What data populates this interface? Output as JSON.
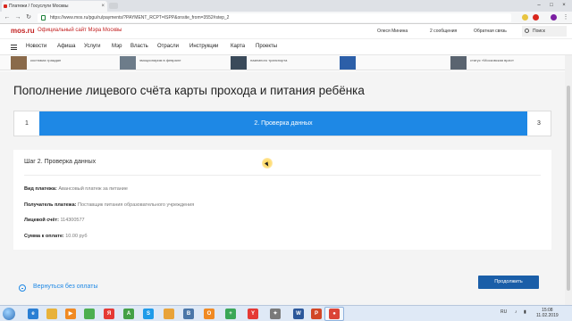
{
  "browser": {
    "tab_title": "Платежи / Госуслуги Москвы",
    "tab_close": "×",
    "url": "https://www.mos.ru/pgu/ru/payments/?PAYMENT_RCPT=ISPP&onsite_from=3552#step_2",
    "window_controls": [
      "–",
      "□",
      "×"
    ]
  },
  "header": {
    "logo": "mos.ru",
    "site_title": "Официальный сайт Мэра Москвы",
    "user_name": "Олеся Минина",
    "messages": "2 сообщения",
    "feedback": "Обратная связь",
    "search_label": "Поиск"
  },
  "nav": {
    "items": [
      "Новости",
      "Афиша",
      "Услуги",
      "Мэр",
      "Власть",
      "Отрасли",
      "Инструкции",
      "Карта",
      "Проекты"
    ]
  },
  "news": {
    "items": [
      {
        "text": "костюмах граждан",
        "color": "#8a6a4a"
      },
      {
        "text": "эмоционирим в феврале",
        "color": "#6d7c8a"
      },
      {
        "text": "наземного транспорта",
        "color": "#3a4a5a"
      },
      {
        "text": "",
        "color": "#2c5fa8"
      },
      {
        "text": "статус «Московская врач»",
        "color": "#5a6470"
      }
    ]
  },
  "page": {
    "title": "Пополнение лицевого счёта карты прохода и питания ребёнка",
    "steps": {
      "step1": "1",
      "step2": "2. Проверка данных",
      "step3": "3"
    },
    "card": {
      "title": "Шаг 2. Проверка данных",
      "rows": [
        {
          "label": "Вид платежа:",
          "value": "Авансовый платеж за питание"
        },
        {
          "label": "Получатель платежа:",
          "value": "Поставщик питания образовательного учреждения"
        },
        {
          "label": "Лицевой счёт:",
          "value": "114300577"
        },
        {
          "label": "Сумма к оплате:",
          "value": "10.00 руб"
        }
      ]
    },
    "back_link": "Вернуться без оплаты",
    "continue_button": "Продолжить"
  },
  "taskbar": {
    "language": "RU",
    "time": "15:08",
    "date": "11.02.2019",
    "apps": [
      {
        "name": "ie",
        "color": "#2a7fd4",
        "glyph": "e"
      },
      {
        "name": "explorer",
        "color": "#e8b23a",
        "glyph": ""
      },
      {
        "name": "media",
        "color": "#f08a24",
        "glyph": "▶"
      },
      {
        "name": "chrome",
        "color": "#4caf50",
        "glyph": ""
      },
      {
        "name": "yandex",
        "color": "#e53935",
        "glyph": "Я"
      },
      {
        "name": "app-a",
        "color": "#43a047",
        "glyph": "A"
      },
      {
        "name": "skype",
        "color": "#1e9be9",
        "glyph": "S"
      },
      {
        "name": "folder",
        "color": "#e8a33a",
        "glyph": ""
      },
      {
        "name": "vk",
        "color": "#4a76a8",
        "glyph": "B"
      },
      {
        "name": "odnoklassniki",
        "color": "#f08a24",
        "glyph": "О"
      },
      {
        "name": "green-app",
        "color": "#3aa757",
        "glyph": "+"
      },
      {
        "name": "yandex-browser",
        "color": "#e53935",
        "glyph": "Y"
      },
      {
        "name": "settings",
        "color": "#7a7a7a",
        "glyph": "✦"
      },
      {
        "name": "word",
        "color": "#2b579a",
        "glyph": "W"
      },
      {
        "name": "powerpoint",
        "color": "#d24726",
        "glyph": "P"
      },
      {
        "name": "chrome-active",
        "color": "#db4437",
        "glyph": "●"
      }
    ]
  }
}
